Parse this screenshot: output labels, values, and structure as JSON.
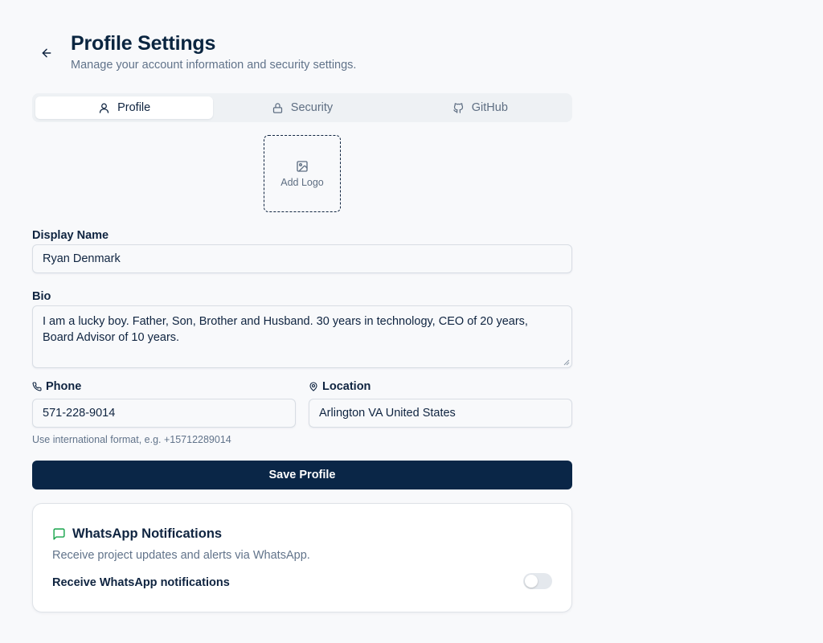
{
  "header": {
    "title": "Profile Settings",
    "subtitle": "Manage your account information and security settings."
  },
  "tabs": [
    {
      "label": "Profile",
      "icon": "user-icon",
      "active": true
    },
    {
      "label": "Security",
      "icon": "lock-icon",
      "active": false
    },
    {
      "label": "GitHub",
      "icon": "github-icon",
      "active": false
    }
  ],
  "logo_upload": {
    "label": "Add Logo",
    "icon": "image-icon"
  },
  "form": {
    "display_name": {
      "label": "Display Name",
      "value": "Ryan Denmark"
    },
    "bio": {
      "label": "Bio",
      "value": "I am a lucky boy.  Father, Son, Brother and Husband. 30 years in technology, CEO of 20 years, Board Advisor of 10 years."
    },
    "phone": {
      "label": "Phone",
      "icon": "phone-icon",
      "value": "571-228-9014",
      "hint": "Use international format, e.g. +15712289014"
    },
    "location": {
      "label": "Location",
      "icon": "map-pin-icon",
      "value": "Arlington VA United States"
    },
    "save_label": "Save Profile"
  },
  "whatsapp": {
    "title": "WhatsApp Notifications",
    "icon": "message-square-icon",
    "description": "Receive project updates and alerts via WhatsApp.",
    "toggle_label": "Receive WhatsApp notifications",
    "enabled": false
  },
  "colors": {
    "primary": "#0a2647",
    "whatsapp_icon": "#16a34a",
    "muted_text": "#61738a"
  }
}
